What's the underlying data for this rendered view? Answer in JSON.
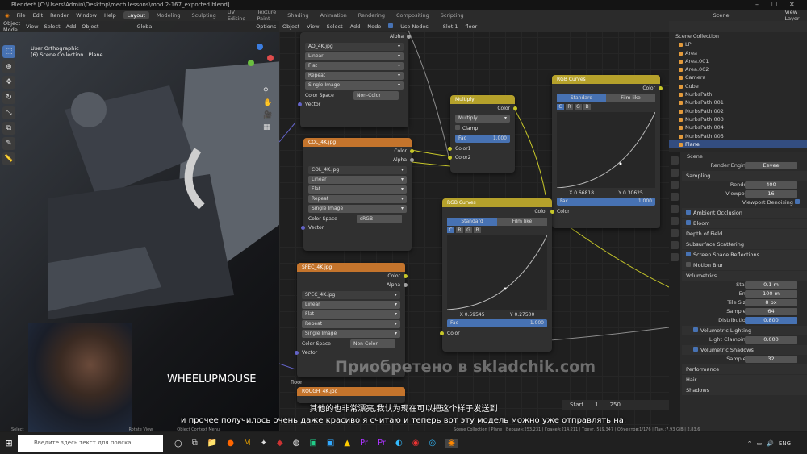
{
  "window": {
    "title": "Blender* [C:\\Users\\Admin\\Desktop\\mech lessons\\mod 2-167_exported.blend]"
  },
  "menu": {
    "items": [
      "File",
      "Edit",
      "Render",
      "Window",
      "Help"
    ],
    "workspaces": [
      "Layout",
      "Modeling",
      "Sculpting",
      "UV Editing",
      "Texture Paint",
      "Shading",
      "Animation",
      "Rendering",
      "Compositing",
      "Scripting"
    ],
    "scene": "Scene",
    "view_layer": "View Layer"
  },
  "viewport": {
    "mode": "Object Mode",
    "menus": [
      "View",
      "Select",
      "Add",
      "Object"
    ],
    "orientation": "Global",
    "options": "Options",
    "overlay_line1": "User Orthographic",
    "overlay_line2": "(6) Scene Collection | Plane"
  },
  "node_editor": {
    "type": "Object",
    "menus": [
      "View",
      "Select",
      "Add",
      "Node"
    ],
    "use_nodes": "Use Nodes",
    "slot": "Slot 1",
    "material": "floor",
    "floor_label": "floor"
  },
  "nodes": {
    "ao": {
      "file": "AO_4K.jpg",
      "alpha": "Alpha",
      "opts": [
        "Linear",
        "Flat",
        "Repeat",
        "Single Image"
      ],
      "cs_label": "Color Space",
      "cs": "Non-Color",
      "vector": "Vector"
    },
    "col": {
      "title": "COL_4K.jpg",
      "color": "Color",
      "alpha": "Alpha",
      "file": "COL_4K.jpg",
      "opts": [
        "Linear",
        "Flat",
        "Repeat",
        "Single Image"
      ],
      "cs_label": "Color Space",
      "cs": "sRGB",
      "vector": "Vector"
    },
    "spec": {
      "title": "SPEC_4K.jpg",
      "color": "Color",
      "alpha": "Alpha",
      "file": "SPEC_4K.jpg",
      "opts": [
        "Linear",
        "Flat",
        "Repeat",
        "Single Image"
      ],
      "cs_label": "Color Space",
      "cs": "Non-Color",
      "vector": "Vector"
    },
    "rough": {
      "title": "ROUGH_4K.jpg"
    },
    "multiply": {
      "title": "Multiply",
      "color": "Color",
      "op": "Multiply",
      "clamp": "Clamp",
      "fac": "Fac",
      "fac_val": "1.000",
      "c1": "Color1",
      "c2": "Color2"
    },
    "rgb1": {
      "title": "RGB Curves",
      "color": "Color",
      "tab1": "Standard",
      "tab2": "Film like",
      "ch": [
        "C",
        "R",
        "G",
        "B"
      ],
      "x": "X 0.66818",
      "y": "Y 0.30625",
      "fac": "Fac",
      "fac_val": "1.000",
      "in": "Color"
    },
    "rgb2": {
      "title": "RGB Curves",
      "color": "Color",
      "tab1": "Standard",
      "tab2": "Film like",
      "ch": [
        "C",
        "R",
        "G",
        "B"
      ],
      "x": "X 0.59545",
      "y": "Y 0.27500",
      "fac": "Fac",
      "fac_val": "1.000",
      "in": "Color"
    }
  },
  "outliner": {
    "items": [
      "Scene Collection",
      "LP",
      "Area",
      "Area.001",
      "Area.002",
      "Camera",
      "Cube",
      "NurbsPath",
      "NurbsPath.001",
      "NurbsPath.002",
      "NurbsPath.003",
      "NurbsPath.004",
      "NurbsPath.005",
      "Plane"
    ]
  },
  "properties": {
    "scene": "Scene",
    "engine_label": "Render Engine",
    "engine": "Eevee",
    "sampling": "Sampling",
    "render_label": "Render",
    "render": "400",
    "viewport_label": "Viewport",
    "viewport": "16",
    "denoise": "Viewport Denoising",
    "sections": [
      "Ambient Occlusion",
      "Bloom",
      "Depth of Field",
      "Subsurface Scattering",
      "Screen Space Reflections",
      "Motion Blur",
      "Volumetrics"
    ],
    "start_label": "Start",
    "start": "0.1 m",
    "end_label": "End",
    "end": "100 m",
    "tile_label": "Tile Size",
    "tile": "8 px",
    "samples_label": "Samples",
    "samples": "64",
    "dist_label": "Distribution",
    "dist": "0.800",
    "vol_light": "Volumetric Lighting",
    "light_clamp_label": "Light Clamping",
    "light_clamp": "0.000",
    "vol_shadows": "Volumetric Shadows",
    "shadow_samples_label": "Samples",
    "shadow_samples": "32",
    "bottom": [
      "Performance",
      "Hair",
      "Shadows"
    ]
  },
  "timeline": {
    "start": "Start",
    "start_val": "1",
    "frame": "250"
  },
  "statusbar": {
    "left": "Select",
    "mid": "Rotate View",
    "ctx": "Object Context Menu",
    "right": "Scene Collection | Plane | Вершин:253,231 | Граней:214,211 | Треуг.:519,347 | Объектов:1/176 | Пам.:7.93 GiB | 2.83.6"
  },
  "overlay": {
    "watermark": "Приобретено в skladchik.com",
    "key": "WHEELUPMOUSE",
    "sub_cn": "其他的也非常漂亮,我认为现在可以把这个样子发送到",
    "sub_ru": "и прочее получилось очень даже красиво я считаю и теперь вот эту модель можно уже отправлять на,"
  },
  "taskbar": {
    "search": "Введите здесь текст для поиска",
    "lang": "ENG"
  }
}
